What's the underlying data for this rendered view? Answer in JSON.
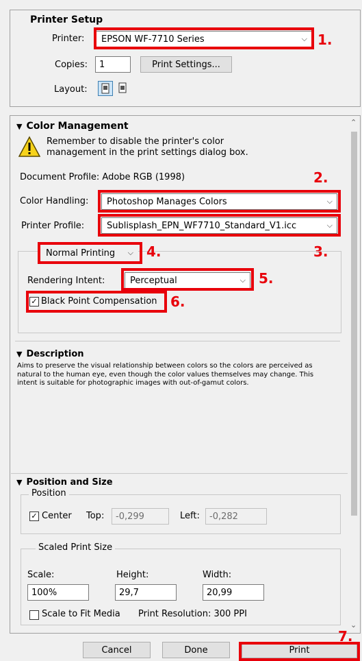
{
  "printer_setup": {
    "heading": "Printer Setup",
    "printer_label": "Printer:",
    "printer_value": "EPSON WF-7710 Series",
    "copies_label": "Copies:",
    "copies_value": "1",
    "print_settings_button": "Print Settings...",
    "layout_label": "Layout:"
  },
  "color_management": {
    "heading": "Color Management",
    "warning": "Remember to disable the printer's color management in the print settings dialog box.",
    "document_profile": "Document Profile: Adobe RGB (1998)",
    "color_handling_label": "Color Handling:",
    "color_handling_value": "Photoshop Manages Colors",
    "printer_profile_label": "Printer Profile:",
    "printer_profile_value": "Sublisplash_EPN_WF7710_Standard_V1.icc",
    "printing_mode_value": "Normal Printing",
    "rendering_intent_label": "Rendering Intent:",
    "rendering_intent_value": "Perceptual",
    "black_point_label": "Black Point Compensation",
    "black_point_checked": true
  },
  "description": {
    "heading": "Description",
    "text": "Aims to preserve the visual relationship between colors so the colors are perceived as natural to the human eye, even though the color values themselves may change. This intent is suitable for photographic images with out-of-gamut colors."
  },
  "position_size": {
    "heading": "Position and Size",
    "position_group": "Position",
    "center_label": "Center",
    "top_label": "Top:",
    "top_value": "-0,299",
    "left_label": "Left:",
    "left_value": "-0,282",
    "scaled_group": "Scaled Print Size",
    "scale_label": "Scale:",
    "scale_value": "100%",
    "height_label": "Height:",
    "height_value": "29,7",
    "width_label": "Width:",
    "width_value": "20,99",
    "scale_fit_label": "Scale to Fit Media",
    "resolution": "Print Resolution: 300 PPI"
  },
  "footer": {
    "cancel": "Cancel",
    "done": "Done",
    "print": "Print"
  },
  "annotations": [
    "1.",
    "2.",
    "3.",
    "4.",
    "5.",
    "6.",
    "7."
  ],
  "colors": {
    "annotation_red": "#e8000b",
    "panel_bg": "#f0f0f0"
  }
}
